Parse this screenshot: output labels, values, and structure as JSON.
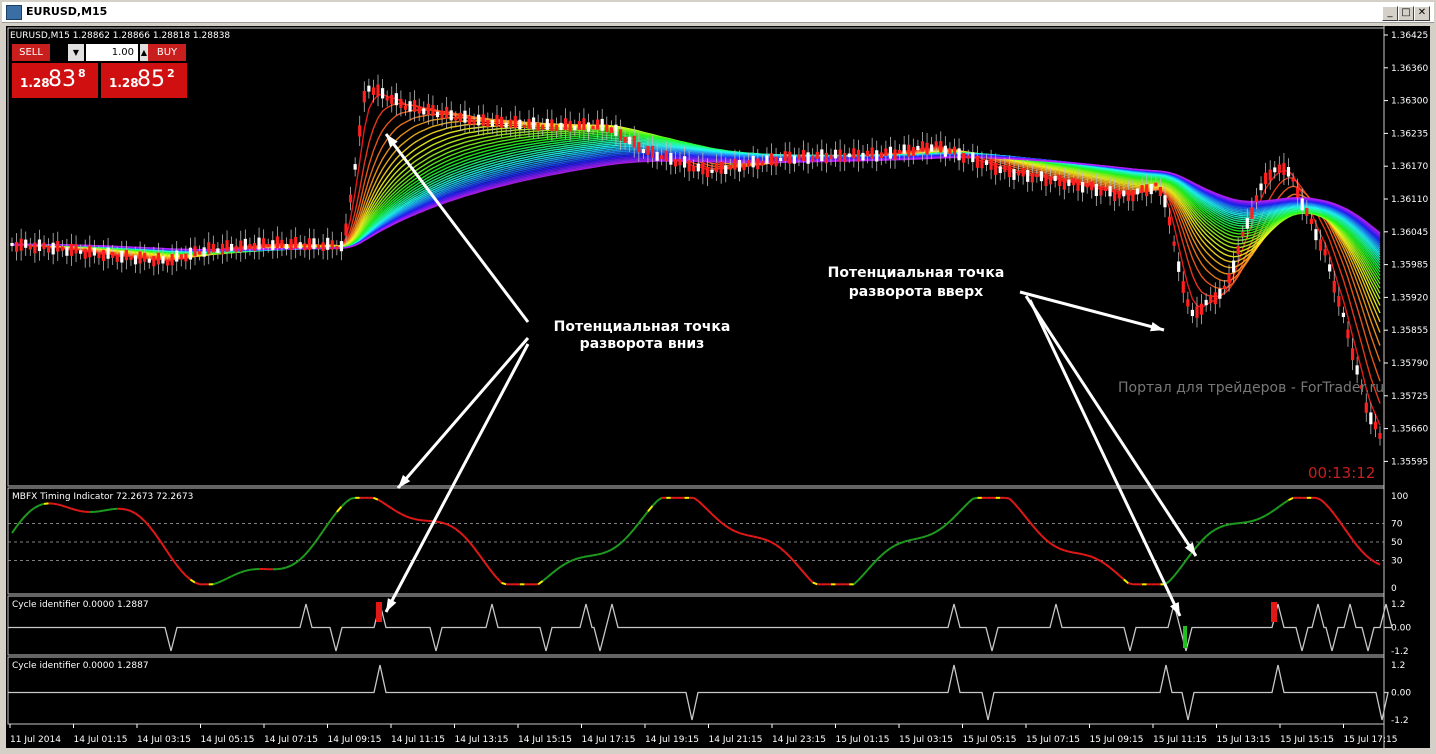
{
  "window": {
    "title": "EURUSD,M15",
    "buttons": [
      "_",
      "□",
      "✕"
    ]
  },
  "chart_header": "EURUSD,M15  1.28862 1.28866 1.28818 1.28838",
  "trade_panel": {
    "sell_label": "SELL",
    "buy_label": "BUY",
    "lot": "1.00",
    "bid_prefix": "1.28",
    "bid_big": "83",
    "bid_sup": "8",
    "ask_prefix": "1.28",
    "ask_big": "85",
    "ask_sup": "2"
  },
  "price_axis": [
    "1.36425",
    "1.36360",
    "1.36300",
    "1.36235",
    "1.36170",
    "1.36110",
    "1.36045",
    "1.35985",
    "1.35920",
    "1.35855",
    "1.35790",
    "1.35725",
    "1.35660",
    "1.35595"
  ],
  "time_axis": [
    "11 Jul 2014",
    "14 Jul 01:15",
    "14 Jul 03:15",
    "14 Jul 05:15",
    "14 Jul 07:15",
    "14 Jul 09:15",
    "14 Jul 11:15",
    "14 Jul 13:15",
    "14 Jul 15:15",
    "14 Jul 17:15",
    "14 Jul 19:15",
    "14 Jul 21:15",
    "14 Jul 23:15",
    "15 Jul 01:15",
    "15 Jul 03:15",
    "15 Jul 05:15",
    "15 Jul 07:15",
    "15 Jul 09:15",
    "15 Jul 11:15",
    "15 Jul 13:15",
    "15 Jul 15:15",
    "15 Jul 17:15"
  ],
  "annotations": {
    "down_line1": "Потенциальная точка",
    "down_line2": "разворота вниз",
    "up_line1": "Потенциальная точка",
    "up_line2": "разворота вверх",
    "watermark": "Портал для трейдеров - ForTrader.ru",
    "timer": "00:13:12"
  },
  "panels": {
    "mbfx_title": "MBFX Timing Indicator 72.2673 72.2673",
    "mbfx_levels": [
      "100",
      "70",
      "50",
      "30",
      "0"
    ],
    "cycle1_title": "Cycle identifier 0.0000 1.2887",
    "cycle1_levels": [
      "1.2",
      "0.00",
      "-1.2"
    ],
    "cycle2_title": "Cycle identifier 0.0000 1.2887",
    "cycle2_levels": [
      "1.2",
      "0.00",
      "-1.2"
    ]
  },
  "colors": {
    "background": "#000000",
    "trade_red": "#d01010",
    "axis_text": "#ffffff",
    "timer": "#c81e1e",
    "watermark": "#777777"
  }
}
